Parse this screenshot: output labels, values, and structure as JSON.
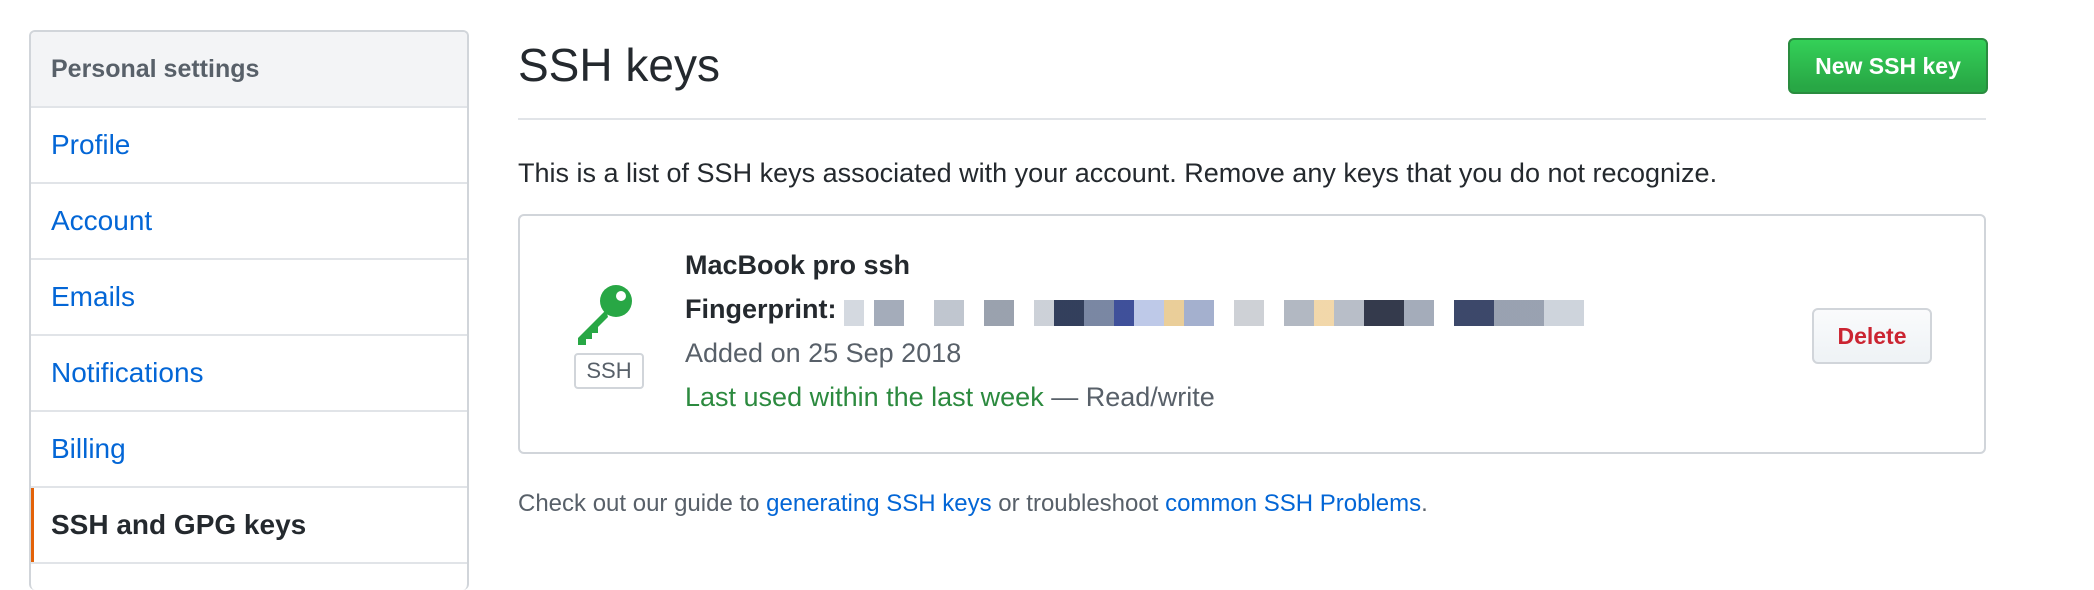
{
  "sidebar": {
    "header": "Personal settings",
    "items": [
      {
        "label": "Profile"
      },
      {
        "label": "Account"
      },
      {
        "label": "Emails"
      },
      {
        "label": "Notifications"
      },
      {
        "label": "Billing"
      },
      {
        "label": "SSH and GPG keys",
        "selected": true
      }
    ]
  },
  "main": {
    "title": "SSH keys",
    "new_key_button": "New SSH key",
    "intro": "This is a list of SSH keys associated with your account. Remove any keys that you do not recognize.",
    "key": {
      "badge": "SSH",
      "title": "MacBook pro ssh",
      "fingerprint_label": "Fingerprint:",
      "added": "Added on 25 Sep 2018",
      "last_used": "Last used within the last week",
      "access": " — Read/write",
      "delete_button": "Delete",
      "icon": "key-icon",
      "icon_color": "#28a745"
    },
    "footer": {
      "prefix": "Check out our guide to ",
      "link1": "generating SSH keys",
      "middle": " or troubleshoot ",
      "link2": "common SSH Problems",
      "suffix": "."
    }
  },
  "colors": {
    "link": "#0366d6",
    "accent_selected": "#e36209",
    "primary_button": "#28a745",
    "danger": "#cb2431"
  }
}
